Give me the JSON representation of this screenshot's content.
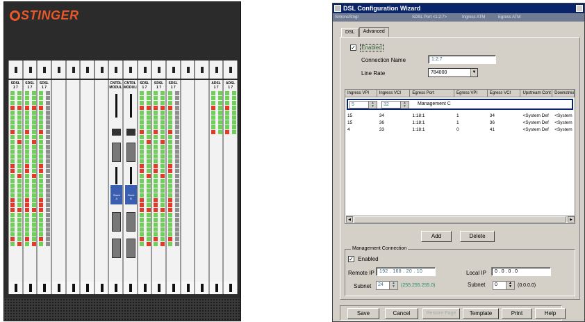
{
  "chassis": {
    "logo": "STINGER",
    "slot_labels": [
      "SDSL\n1 7",
      "SDSL\n1 7",
      "SDSL\n1 7",
      "",
      "",
      "",
      "",
      "CNTRL\nMODULE",
      "CNTRL\nMODULE",
      "SDSL\n1 7",
      "SDSL\n1 7",
      "SDSL\n1 7",
      "",
      "",
      "ADSL\n1 7",
      "ADSL\n1 7"
    ],
    "ctrl_labels": [
      "Stack\nA",
      "Stack\nB"
    ]
  },
  "dialog": {
    "title": "DSL Configuration Wizard",
    "info": {
      "device": "SimonsStngr",
      "port": "SDSL Port <1:2:7>",
      "ingress": "Ingress ATM",
      "egress": "Egress ATM"
    },
    "tabs": [
      "DSL",
      "Advanced"
    ],
    "enabled_label": "Enabled",
    "connection_name_label": "Connection Name",
    "connection_name_value": "1:2:7",
    "line_rate_label": "Line Rate",
    "line_rate_value": "784000",
    "table": {
      "columns": [
        "Ingress VPI",
        "Ingress VCI",
        "Egress Port",
        "Egress VPI",
        "Egress VCI",
        "Upstream Cont",
        "Downstream"
      ],
      "edit_row": {
        "ingress_vpi": "5",
        "ingress_vci": "32",
        "egress_port": "Management C"
      },
      "rows": [
        [
          "15",
          "34",
          "1:18:1",
          "1",
          "34",
          "<System Def",
          "<System"
        ],
        [
          "15",
          "36",
          "1:18:1",
          "1",
          "36",
          "<System Def",
          "<System"
        ],
        [
          "4",
          "33",
          "1:18:1",
          "0",
          "41",
          "<System Def",
          "<System"
        ]
      ]
    },
    "add_label": "Add",
    "delete_label": "Delete",
    "mgmt": {
      "title": "Management Connection",
      "enabled_label": "Enabled",
      "remote_ip_label": "Remote IP",
      "remote_ip_value": "192 . 168 . 20 . 10",
      "local_ip_label": "Local IP",
      "local_ip_value": "0 . 0 . 0 . 0",
      "subnet_label": "Subnet",
      "subnet_value": "24",
      "subnet_mask": "(255.255.255.0)",
      "local_subnet_label": "Subnet",
      "local_subnet_value": "0",
      "local_subnet_mask": "(0.0.0.0)"
    },
    "buttons": {
      "save": "Save",
      "cancel": "Cancel",
      "restore": "Restore Page",
      "template": "Template",
      "print": "Print",
      "help": "Help"
    }
  }
}
